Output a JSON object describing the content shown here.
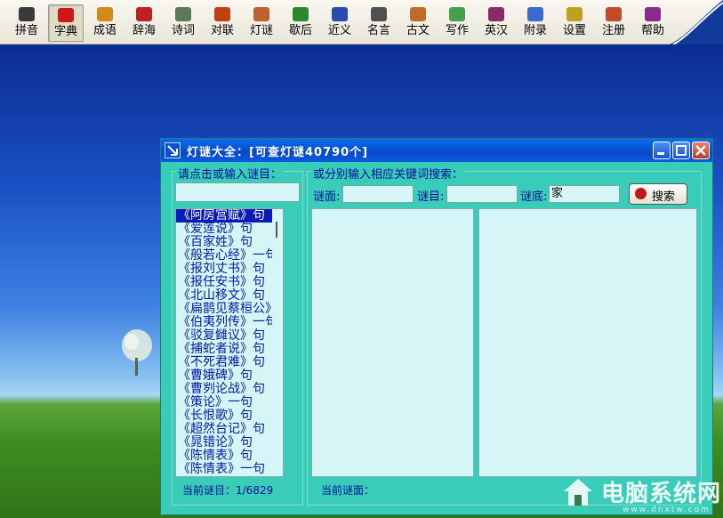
{
  "toolbar": {
    "items": [
      {
        "label": "拼音",
        "icon": "face-icon",
        "color": "#3a3a3a"
      },
      {
        "label": "字典",
        "icon": "red-book-icon",
        "color": "#d01818",
        "active": true
      },
      {
        "label": "成语",
        "icon": "scroll-icon",
        "color": "#d08a18"
      },
      {
        "label": "辞海",
        "icon": "books-icon",
        "color": "#c02020"
      },
      {
        "label": "诗词",
        "icon": "frame-icon",
        "color": "#5a7a5a"
      },
      {
        "label": "对联",
        "icon": "couplet-icon",
        "color": "#c04010"
      },
      {
        "label": "灯谜",
        "icon": "lantern-icon",
        "color": "#c06030"
      },
      {
        "label": "歇后",
        "icon": "stack-icon",
        "color": "#2a8a2a"
      },
      {
        "label": "近义",
        "icon": "open-book-icon",
        "color": "#2a4ab0"
      },
      {
        "label": "名言",
        "icon": "notepad-icon",
        "color": "#505050"
      },
      {
        "label": "古文",
        "icon": "bamboo-icon",
        "color": "#c06a2a"
      },
      {
        "label": "写作",
        "icon": "pen-icon",
        "color": "#4aa04a"
      },
      {
        "label": "英汉",
        "icon": "dictionary-icon",
        "color": "#8a2a6a"
      },
      {
        "label": "附录",
        "icon": "documents-icon",
        "color": "#3a6ad0"
      },
      {
        "label": "设置",
        "icon": "gear-icon",
        "color": "#c0a020"
      },
      {
        "label": "注册",
        "icon": "register-icon",
        "color": "#c04a2a"
      },
      {
        "label": "帮助",
        "icon": "help-book-icon",
        "color": "#8a2a8a"
      }
    ]
  },
  "window": {
    "title": "灯谜大全：[可查灯谜40790个]",
    "left_group_label": "请点击或输入谜目：",
    "right_group_label": "或分别输入相应关键词搜索：",
    "riddle_face_label": "谜面:",
    "riddle_category_label": "谜目:",
    "riddle_answer_label": "谜底:",
    "riddle_face_value": "",
    "riddle_category_value": "",
    "riddle_answer_value": "家",
    "search_button": "搜索",
    "category_input_value": "",
    "current_category_status": "当前谜目：1/6829",
    "current_face_status": "当前谜面："
  },
  "riddle_list": [
    "《阿房宫赋》句",
    "《爱莲说》句",
    "《百家姓》句",
    "《般若心经》一句",
    "《报刘丈书》句",
    "《报任安书》句",
    "《北山移文》句",
    "《扁鹊见蔡桓公》",
    "《伯夷列传》一句",
    "《驳复雠议》句",
    "《捕蛇者说》句",
    "《不死君难》句",
    "《曹娥碑》句",
    "《曹刿论战》句",
    "《策论》一句",
    "《长恨歌》句",
    "《超然台记》句",
    "《晁错论》句",
    "《陈情表》句",
    "《陈情表》一句"
  ],
  "watermark": {
    "text": "电脑系统网",
    "sub": "www.dnxtw.com"
  }
}
